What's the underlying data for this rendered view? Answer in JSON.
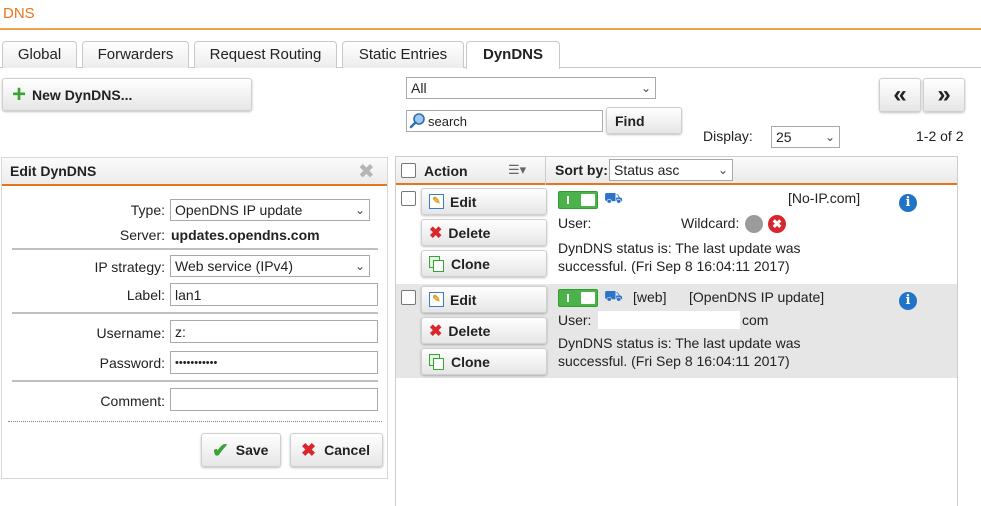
{
  "page": {
    "title": "DNS"
  },
  "tabs": [
    {
      "label": "Global"
    },
    {
      "label": "Forwarders"
    },
    {
      "label": "Request Routing"
    },
    {
      "label": "Static Entries"
    },
    {
      "label": "DynDNS",
      "active": true
    }
  ],
  "toolbar": {
    "new_button": "New DynDNS...",
    "filter_value": "All",
    "search_placeholder": "search",
    "find_button": "Find",
    "display_label": "Display:",
    "display_value": "25",
    "paging": "1-2 of 2",
    "prev_page": "«",
    "next_page": "»"
  },
  "edit_panel": {
    "title": "Edit DynDNS",
    "type_label": "Type:",
    "type_value": "OpenDNS IP update",
    "server_label": "Server:",
    "server_value": "updates.opendns.com",
    "ip_strategy_label": "IP strategy:",
    "ip_strategy_value": "Web service (IPv4)",
    "label_label": "Label:",
    "label_value": "lan1",
    "username_label": "Username:",
    "username_value": "z:",
    "password_label": "Password:",
    "password_value": "•••••••••••",
    "comment_label": "Comment:",
    "comment_value": "",
    "save_button": "Save",
    "cancel_button": "Cancel"
  },
  "grid": {
    "action_header": "Action",
    "sort_label": "Sort by:",
    "sort_value": "Status asc",
    "actions": {
      "edit": "Edit",
      "delete": "Delete",
      "clone": "Clone"
    },
    "rows": [
      {
        "name": "",
        "provider": "[No-IP.com]",
        "user_label": "User:",
        "user_value": "",
        "wildcard_label": "Wildcard:",
        "status_line1": "DynDNS status is: The last update was",
        "status_line2": "successful. (Fri Sep 8 16:04:11 2017)"
      },
      {
        "name": "[web]",
        "provider": "[OpenDNS IP update]",
        "user_label": "User:",
        "user_value": "com",
        "status_line1": "DynDNS status is: The last update was",
        "status_line2": "successful. (Fri Sep 8 16:04:11 2017)"
      }
    ]
  },
  "colors": {
    "accent": "#e8751a",
    "enabled_green": "#4cb34c",
    "info_blue": "#1f74c7",
    "delete_red": "#d9262c"
  }
}
